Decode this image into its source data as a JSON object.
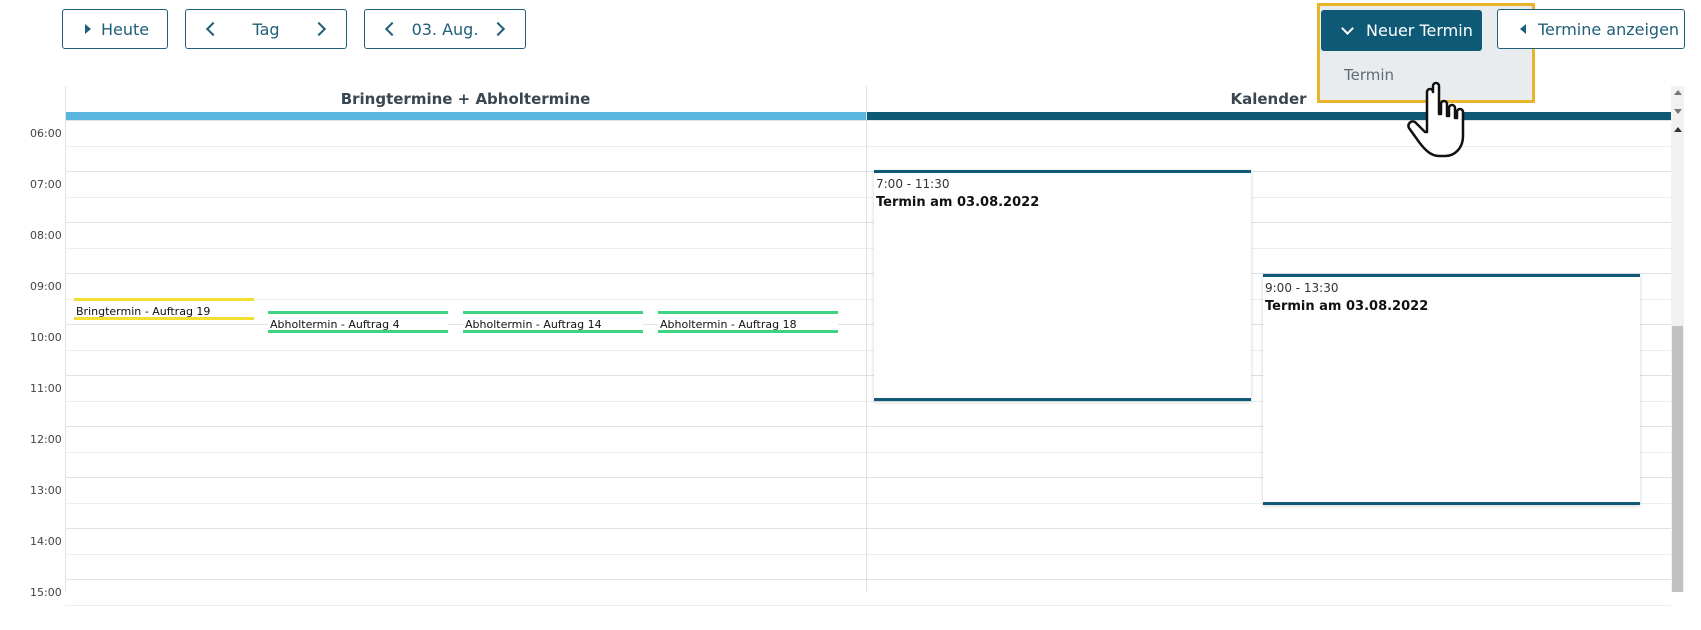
{
  "toolbar": {
    "today_label": "Heute",
    "view_label": "Tag",
    "date_label": "03. Aug.",
    "new_appointment_label": "Neuer Termin",
    "show_appointments_label": "Termine anzeigen"
  },
  "dropdown": {
    "items": [
      "Termin"
    ]
  },
  "columns": [
    {
      "title": "Bringtermine + Abholtermine",
      "color": "#5ab6df"
    },
    {
      "title": "Kalender",
      "color": "#0e5a76"
    }
  ],
  "times": [
    "06:00",
    "07:00",
    "08:00",
    "09:00",
    "10:00",
    "11:00",
    "12:00",
    "13:00",
    "14:00",
    "15:00"
  ],
  "events": [
    {
      "label": "Bringtermin - Auftrag 19",
      "color": "#f2df30"
    },
    {
      "label": "Abholtermin - Auftrag 4",
      "color": "#3ed381"
    },
    {
      "label": "Abholtermin - Auftrag 14",
      "color": "#3ed381"
    },
    {
      "label": "Abholtermin - Auftrag 18",
      "color": "#3ed381"
    }
  ],
  "appointments": [
    {
      "time": "7:00 - 11:30",
      "title": "Termin am 03.08.2022"
    },
    {
      "time": "9:00 - 13:30",
      "title": "Termin am 03.08.2022"
    }
  ]
}
